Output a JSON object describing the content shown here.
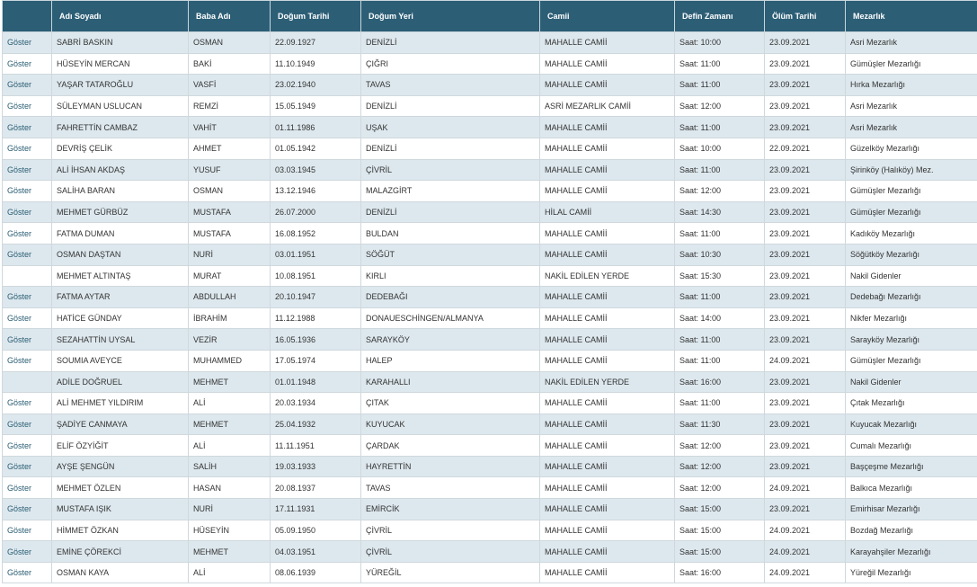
{
  "headers": [
    "",
    "Adı Soyadı",
    "Baba Adı",
    "Doğum Tarihi",
    "Doğum Yeri",
    "Camii",
    "Defin Zamanı",
    "Ölüm Tarihi",
    "Mezarlık"
  ],
  "rows": [
    {
      "action": "Göster",
      "name": "SABRİ BASKIN",
      "father": "OSMAN",
      "birth_date": "22.09.1927",
      "birth_place": "DENİZLİ",
      "mosque": "MAHALLE CAMİİ",
      "burial_time": "Saat: 10:00",
      "death_date": "23.09.2021",
      "cemetery": "Asri Mezarlık"
    },
    {
      "action": "Göster",
      "name": "HÜSEYİN MERCAN",
      "father": "BAKİ",
      "birth_date": "11.10.1949",
      "birth_place": "ÇIĞRI",
      "mosque": "MAHALLE CAMİİ",
      "burial_time": "Saat: 11:00",
      "death_date": "23.09.2021",
      "cemetery": "Gümüşler Mezarlığı"
    },
    {
      "action": "Göster",
      "name": "YAŞAR TATAROĞLU",
      "father": "VASFİ",
      "birth_date": "23.02.1940",
      "birth_place": "TAVAS",
      "mosque": "MAHALLE CAMİİ",
      "burial_time": "Saat: 11:00",
      "death_date": "23.09.2021",
      "cemetery": "Hırka Mezarlığı"
    },
    {
      "action": "Göster",
      "name": "SÜLEYMAN USLUCAN",
      "father": "REMZİ",
      "birth_date": "15.05.1949",
      "birth_place": "DENİZLİ",
      "mosque": "ASRİ MEZARLIK CAMİİ",
      "burial_time": "Saat: 12:00",
      "death_date": "23.09.2021",
      "cemetery": "Asri Mezarlık"
    },
    {
      "action": "Göster",
      "name": "FAHRETTİN CAMBAZ",
      "father": "VAHİT",
      "birth_date": "01.11.1986",
      "birth_place": "UŞAK",
      "mosque": "MAHALLE CAMİİ",
      "burial_time": "Saat: 11:00",
      "death_date": "23.09.2021",
      "cemetery": "Asri Mezarlık"
    },
    {
      "action": "Göster",
      "name": "DEVRİŞ ÇELİK",
      "father": "AHMET",
      "birth_date": "01.05.1942",
      "birth_place": "DENİZLİ",
      "mosque": "MAHALLE CAMİİ",
      "burial_time": "Saat: 10:00",
      "death_date": "22.09.2021",
      "cemetery": "Güzelköy Mezarlığı"
    },
    {
      "action": "Göster",
      "name": "ALİ İHSAN AKDAŞ",
      "father": "YUSUF",
      "birth_date": "03.03.1945",
      "birth_place": "ÇİVRİL",
      "mosque": "MAHALLE CAMİİ",
      "burial_time": "Saat: 11:00",
      "death_date": "23.09.2021",
      "cemetery": "Şirinköy (Halıköy) Mez."
    },
    {
      "action": "Göster",
      "name": "SALİHA BARAN",
      "father": "OSMAN",
      "birth_date": "13.12.1946",
      "birth_place": "MALAZGİRT",
      "mosque": "MAHALLE CAMİİ",
      "burial_time": "Saat: 12:00",
      "death_date": "23.09.2021",
      "cemetery": "Gümüşler Mezarlığı"
    },
    {
      "action": "Göster",
      "name": "MEHMET GÜRBÜZ",
      "father": "MUSTAFA",
      "birth_date": "26.07.2000",
      "birth_place": "DENİZLİ",
      "mosque": "HİLAL CAMİİ",
      "burial_time": "Saat: 14:30",
      "death_date": "23.09.2021",
      "cemetery": "Gümüşler Mezarlığı"
    },
    {
      "action": "Göster",
      "name": "FATMA DUMAN",
      "father": "MUSTAFA",
      "birth_date": "16.08.1952",
      "birth_place": "BULDAN",
      "mosque": "MAHALLE CAMİİ",
      "burial_time": "Saat: 11:00",
      "death_date": "23.09.2021",
      "cemetery": "Kadıköy Mezarlığı"
    },
    {
      "action": "Göster",
      "name": "OSMAN DAŞTAN",
      "father": "NURİ",
      "birth_date": "03.01.1951",
      "birth_place": "SÖĞÜT",
      "mosque": "MAHALLE CAMİİ",
      "burial_time": "Saat: 10:30",
      "death_date": "23.09.2021",
      "cemetery": "Söğütköy Mezarlığı"
    },
    {
      "action": "",
      "name": "MEHMET ALTINTAŞ",
      "father": "MURAT",
      "birth_date": "10.08.1951",
      "birth_place": "KIRLI",
      "mosque": "NAKİL EDİLEN YERDE",
      "burial_time": "Saat: 15:30",
      "death_date": "23.09.2021",
      "cemetery": "Nakil Gidenler"
    },
    {
      "action": "Göster",
      "name": "FATMA AYTAR",
      "father": "ABDULLAH",
      "birth_date": "20.10.1947",
      "birth_place": "DEDEBAĞI",
      "mosque": "MAHALLE CAMİİ",
      "burial_time": "Saat: 11:00",
      "death_date": "23.09.2021",
      "cemetery": "Dedebağı Mezarlığı"
    },
    {
      "action": "Göster",
      "name": "HATİCE GÜNDAY",
      "father": "İBRAHİM",
      "birth_date": "11.12.1988",
      "birth_place": "DONAUESCHİNGEN/ALMANYA",
      "mosque": "MAHALLE CAMİİ",
      "burial_time": "Saat: 14:00",
      "death_date": "23.09.2021",
      "cemetery": "Nikfer Mezarlığı"
    },
    {
      "action": "Göster",
      "name": "SEZAHATTİN UYSAL",
      "father": "VEZİR",
      "birth_date": "16.05.1936",
      "birth_place": "SARAYKÖY",
      "mosque": "MAHALLE CAMİİ",
      "burial_time": "Saat: 11:00",
      "death_date": "23.09.2021",
      "cemetery": "Sarayköy Mezarlığı"
    },
    {
      "action": "Göster",
      "name": "SOUMIA AVEYCE",
      "father": "MUHAMMED",
      "birth_date": "17.05.1974",
      "birth_place": "HALEP",
      "mosque": "MAHALLE CAMİİ",
      "burial_time": "Saat: 11:00",
      "death_date": "24.09.2021",
      "cemetery": "Gümüşler Mezarlığı"
    },
    {
      "action": "",
      "name": "ADİLE DOĞRUEL",
      "father": "MEHMET",
      "birth_date": "01.01.1948",
      "birth_place": "KARAHALLI",
      "mosque": "NAKİL EDİLEN YERDE",
      "burial_time": "Saat: 16:00",
      "death_date": "23.09.2021",
      "cemetery": "Nakil Gidenler"
    },
    {
      "action": "Göster",
      "name": "ALİ MEHMET YILDIRIM",
      "father": "ALİ",
      "birth_date": "20.03.1934",
      "birth_place": "ÇITAK",
      "mosque": "MAHALLE CAMİİ",
      "burial_time": "Saat: 11:00",
      "death_date": "23.09.2021",
      "cemetery": "Çıtak Mezarlığı"
    },
    {
      "action": "Göster",
      "name": "ŞADİYE CANMAYA",
      "father": "MEHMET",
      "birth_date": "25.04.1932",
      "birth_place": "KUYUCAK",
      "mosque": "MAHALLE CAMİİ",
      "burial_time": "Saat: 11:30",
      "death_date": "23.09.2021",
      "cemetery": "Kuyucak Mezarlığı"
    },
    {
      "action": "Göster",
      "name": "ELİF ÖZYİĞİT",
      "father": "ALİ",
      "birth_date": "11.11.1951",
      "birth_place": "ÇARDAK",
      "mosque": "MAHALLE CAMİİ",
      "burial_time": "Saat: 12:00",
      "death_date": "23.09.2021",
      "cemetery": "Cumalı Mezarlığı"
    },
    {
      "action": "Göster",
      "name": "AYŞE ŞENGÜN",
      "father": "SALİH",
      "birth_date": "19.03.1933",
      "birth_place": "HAYRETTİN",
      "mosque": "MAHALLE CAMİİ",
      "burial_time": "Saat: 12:00",
      "death_date": "23.09.2021",
      "cemetery": "Başçeşme Mezarlığı"
    },
    {
      "action": "Göster",
      "name": "MEHMET ÖZLEN",
      "father": "HASAN",
      "birth_date": "20.08.1937",
      "birth_place": "TAVAS",
      "mosque": "MAHALLE CAMİİ",
      "burial_time": "Saat: 12:00",
      "death_date": "24.09.2021",
      "cemetery": "Balkıca Mezarlığı"
    },
    {
      "action": "Göster",
      "name": "MUSTAFA IŞIK",
      "father": "NURİ",
      "birth_date": "17.11.1931",
      "birth_place": "EMİRCİK",
      "mosque": "MAHALLE CAMİİ",
      "burial_time": "Saat: 15:00",
      "death_date": "23.09.2021",
      "cemetery": "Emirhisar Mezarlığı"
    },
    {
      "action": "Göster",
      "name": "HİMMET ÖZKAN",
      "father": "HÜSEYİN",
      "birth_date": "05.09.1950",
      "birth_place": "ÇİVRİL",
      "mosque": "MAHALLE CAMİİ",
      "burial_time": "Saat: 15:00",
      "death_date": "24.09.2021",
      "cemetery": "Bozdağ Mezarlığı"
    },
    {
      "action": "Göster",
      "name": "EMİNE ÇÖREKCİ",
      "father": "MEHMET",
      "birth_date": "04.03.1951",
      "birth_place": "ÇİVRİL",
      "mosque": "MAHALLE CAMİİ",
      "burial_time": "Saat: 15:00",
      "death_date": "24.09.2021",
      "cemetery": "Karayahşiler Mezarlığı"
    },
    {
      "action": "Göster",
      "name": "OSMAN KAYA",
      "father": "ALİ",
      "birth_date": "08.06.1939",
      "birth_place": "YÜREĞİL",
      "mosque": "MAHALLE CAMİİ",
      "burial_time": "Saat: 16:00",
      "death_date": "24.09.2021",
      "cemetery": "Yüreğil Mezarlığı"
    }
  ]
}
